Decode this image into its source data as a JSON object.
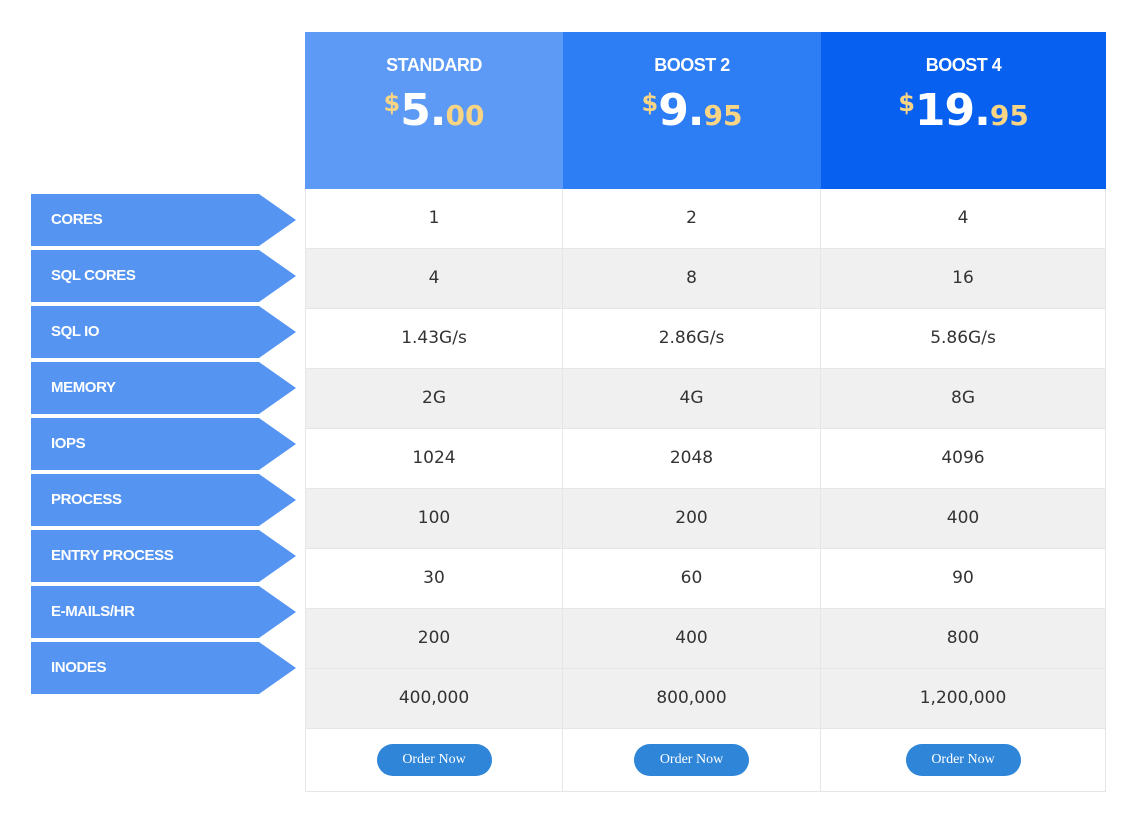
{
  "colors": {
    "label_bg": "#5594f1",
    "standard_header": "#5d9af5",
    "boost2_header": "#2d7df5",
    "boost4_header": "#0760f0",
    "price_accent": "#f7d584",
    "order_button": "#2f86d8",
    "stripe_gray": "#f0f0f0"
  },
  "plans": [
    {
      "name": "STANDARD",
      "currency": "$",
      "whole": "5.",
      "cents": "00",
      "order_label": "Order Now"
    },
    {
      "name": "BOOST 2",
      "currency": "$",
      "whole": "9.",
      "cents": "95",
      "order_label": "Order Now"
    },
    {
      "name": "BOOST 4",
      "currency": "$",
      "whole": "19.",
      "cents": "95",
      "order_label": "Order Now"
    }
  ],
  "features": [
    {
      "label": "CORES",
      "values": [
        "1",
        "2",
        "4"
      ]
    },
    {
      "label": "SQL CORES",
      "values": [
        "4",
        "8",
        "16"
      ]
    },
    {
      "label": "SQL IO",
      "values": [
        "1.43G/s",
        "2.86G/s",
        "5.86G/s"
      ]
    },
    {
      "label": "MEMORY",
      "values": [
        "2G",
        "4G",
        "8G"
      ]
    },
    {
      "label": "IOPS",
      "values": [
        "1024",
        "2048",
        "4096"
      ]
    },
    {
      "label": "PROCESS",
      "values": [
        "100",
        "200",
        "400"
      ]
    },
    {
      "label": "ENTRY PROCESS",
      "values": [
        "30",
        "60",
        "90"
      ]
    },
    {
      "label": "E-MAILS/HR",
      "values": [
        "200",
        "400",
        "800"
      ]
    },
    {
      "label": "INODES",
      "values": [
        "400,000",
        "800,000",
        "1,200,000"
      ]
    }
  ]
}
